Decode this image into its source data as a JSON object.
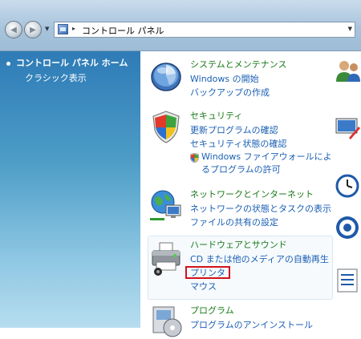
{
  "address_bar": {
    "separator": "▸",
    "path": "コントロール パネル"
  },
  "sidebar": {
    "home_label": "コントロール パネル ホーム",
    "classic_label": "クラシック表示"
  },
  "categories": {
    "system": {
      "title": "システムとメンテナンス",
      "links": [
        "Windows の開始",
        "バックアップの作成"
      ]
    },
    "security": {
      "title": "セキュリティ",
      "links": [
        "更新プログラムの確認",
        "セキュリティ状態の確認",
        "Windows ファイアウォールによるプログラムの許可"
      ]
    },
    "network": {
      "title": "ネットワークとインターネット",
      "links": [
        "ネットワークの状態とタスクの表示",
        "ファイルの共有の設定"
      ]
    },
    "hardware": {
      "title": "ハードウェアとサウンド",
      "links": [
        "CD または他のメディアの自動再生",
        "プリンタ",
        "マウス"
      ]
    },
    "programs": {
      "title": "プログラム",
      "links": [
        "プログラムのアンインストール"
      ]
    }
  },
  "colors": {
    "category_title": "#1a7a1a",
    "link": "#1a5fb4",
    "highlight_box": "#d2121b"
  }
}
